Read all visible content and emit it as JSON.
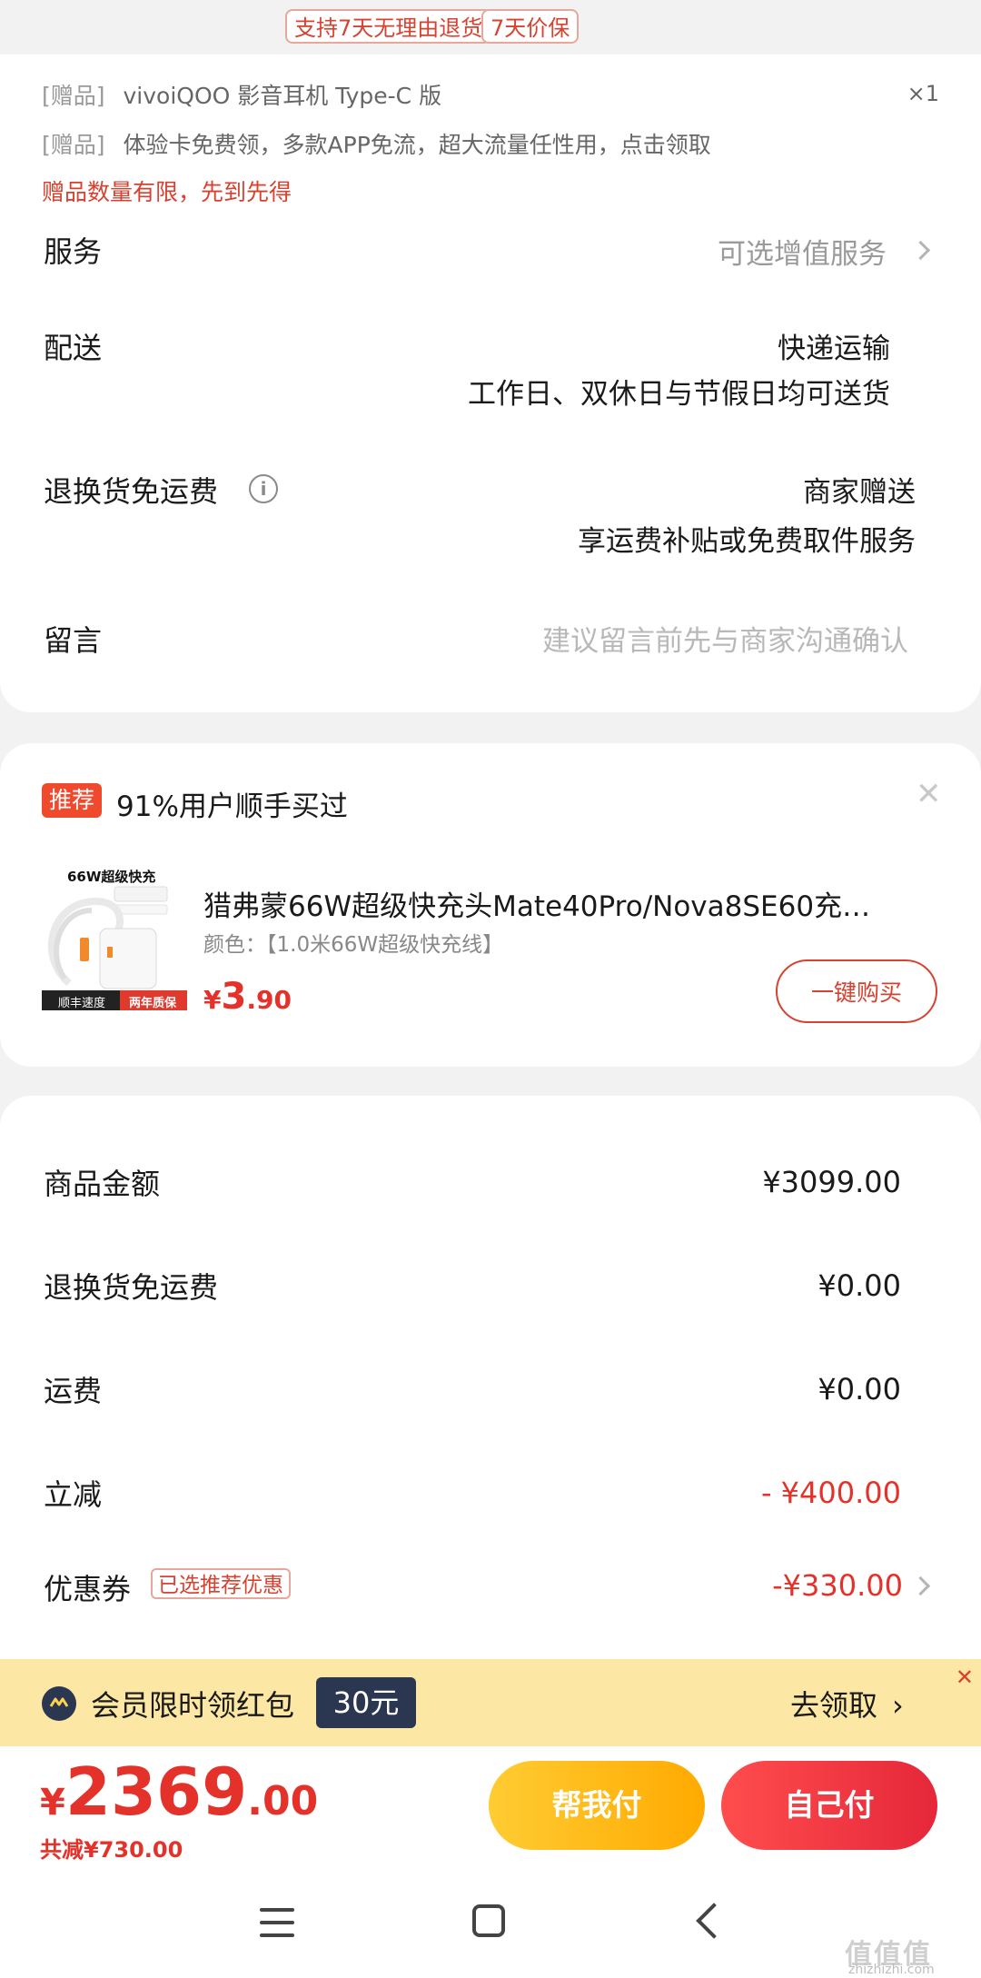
{
  "promo_tags": [
    "支持7天无理由退货",
    "7天价保"
  ],
  "gifts": [
    {
      "prefix": "[赠品]",
      "text": "vivoiQOO 影音耳机 Type-C 版",
      "qty": "×1"
    },
    {
      "prefix": "[赠品]",
      "text": "体验卡免费领，多款APP免流，超大流量任性用，点击领取"
    }
  ],
  "gift_note": "赠品数量有限，先到先得",
  "service": {
    "label": "服务",
    "value": "可选增值服务"
  },
  "delivery": {
    "label": "配送",
    "line1": "快递运输",
    "line2": "工作日、双休日与节假日均可送货"
  },
  "return_fee": {
    "label": "退换货免运费",
    "line1": "商家赠送",
    "line2": "享运费补贴或免费取件服务"
  },
  "message": {
    "label": "留言",
    "placeholder": "建议留言前先与商家沟通确认"
  },
  "recommend": {
    "badge": "推荐",
    "title": "91%用户顺手买过",
    "product": {
      "img_title": "66W超级快充",
      "img_tag_left": "顺丰速度",
      "img_tag_right": "两年质保",
      "name": "猎弗蒙66W超级快充头Mate40Pro/Nova8SE60充…",
      "attr": "颜色：【1.0米66W超级快充线】",
      "price_currency": "¥",
      "price_int": "3",
      "price_dec": ".90",
      "buy_label": "一键购买"
    }
  },
  "summary": [
    {
      "label": "商品金额",
      "value": "¥3099.00"
    },
    {
      "label": "退换货免运费",
      "value": "¥0.00"
    },
    {
      "label": "运费",
      "value": "¥0.00"
    },
    {
      "label": "立减",
      "value": "- ¥400.00"
    },
    {
      "label": "优惠券",
      "tag": "已选推荐优惠",
      "value": "-¥330.00"
    }
  ],
  "member": {
    "text": "会员限时领红包",
    "amount": "30元",
    "cta": "去领取",
    "close": "✕"
  },
  "total": {
    "currency": "¥",
    "int": "2369",
    "dec": ".00",
    "saved": "共减¥730.00"
  },
  "buttons": {
    "help": "帮我付",
    "self": "自己付"
  },
  "watermark": {
    "main": "值值值",
    "sub": "zhizhizhi.com"
  },
  "colors": {
    "accent_red": "#e4322a",
    "member_bg": "#fde7a4",
    "help_yellow": "#ffb800"
  }
}
